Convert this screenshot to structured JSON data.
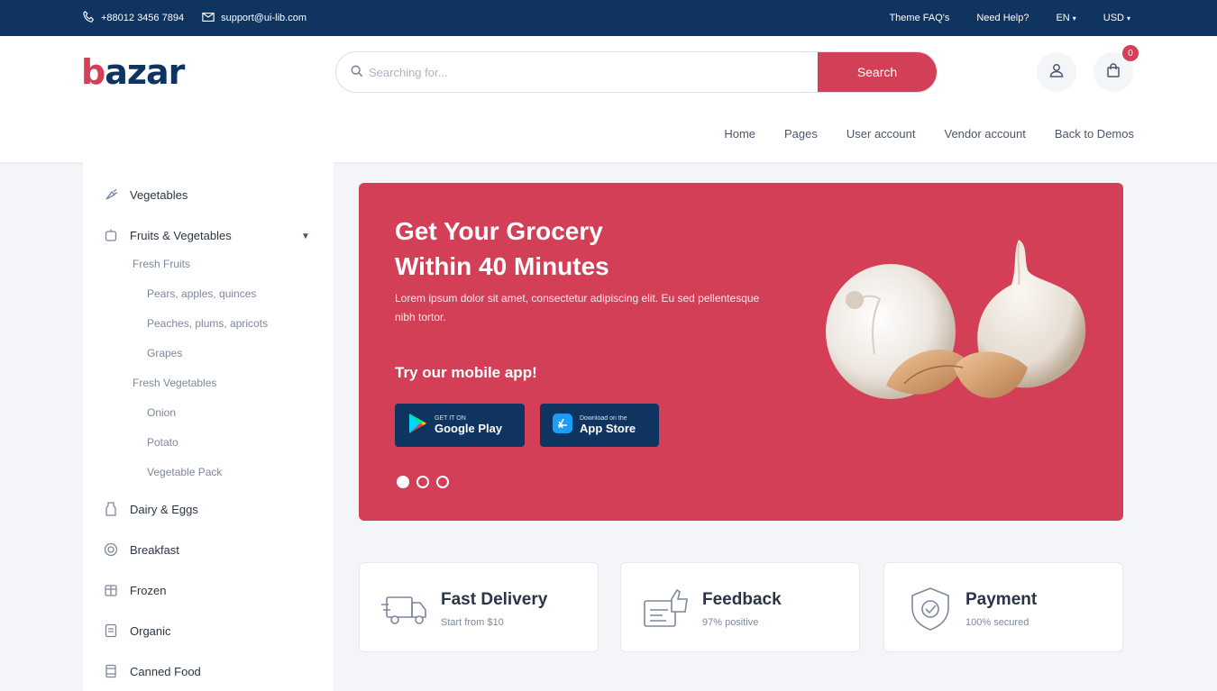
{
  "topbar": {
    "phone": "+88012 3456 7894",
    "email": "support@ui-lib.com",
    "links": [
      "Theme FAQ's",
      "Need Help?"
    ],
    "language": "EN",
    "currency": "USD"
  },
  "header": {
    "logo": {
      "first": "b",
      "rest": "azar"
    },
    "search_placeholder": "Searching for...",
    "search_button": "Search",
    "cart_count": "0",
    "nav": [
      "Home",
      "Pages",
      "User account",
      "Vendor account",
      "Back to Demos"
    ]
  },
  "sidebar": {
    "categories": [
      {
        "label": "Vegetables",
        "icon": "carrot-icon"
      },
      {
        "label": "Fruits & Vegetables",
        "icon": "apple-icon"
      },
      {
        "label": "Dairy & Eggs",
        "icon": "milk-icon"
      },
      {
        "label": "Breakfast",
        "icon": "breakfast-icon"
      },
      {
        "label": "Frozen",
        "icon": "frozen-icon"
      },
      {
        "label": "Organic",
        "icon": "organic-icon"
      },
      {
        "label": "Canned Food",
        "icon": "canned-food-icon"
      }
    ],
    "subgroups": [
      {
        "label": "Fresh Fruits",
        "items": [
          "Pears, apples, quinces",
          "Peaches, plums, apricots",
          "Grapes"
        ]
      },
      {
        "label": "Fresh Vegetables",
        "items": [
          "Onion",
          "Potato",
          "Vegetable Pack"
        ]
      }
    ]
  },
  "hero": {
    "title_line1": "Get Your Grocery",
    "title_line2": "Within 40 Minutes",
    "description": "Lorem ipsum dolor sit amet, consectetur adipiscing elit. Eu sed pellentesque nibh tortor.",
    "cta": "Try our mobile app!",
    "google_play": {
      "small": "GET IT ON",
      "big": "Google Play"
    },
    "app_store": {
      "small": "Download on the",
      "big": "App Store"
    },
    "slide_count": 3,
    "active_slide": 1
  },
  "features": [
    {
      "title": "Fast Delivery",
      "subtitle": "Start from $10",
      "icon": "delivery-truck-icon"
    },
    {
      "title": "Feedback",
      "subtitle": "97% positive",
      "icon": "feedback-icon"
    },
    {
      "title": "Payment",
      "subtitle": "100% secured",
      "icon": "secure-payment-icon"
    }
  ],
  "colors": {
    "primary": "#d23f57",
    "navy": "#0f3460",
    "background": "#f3f5f9"
  }
}
